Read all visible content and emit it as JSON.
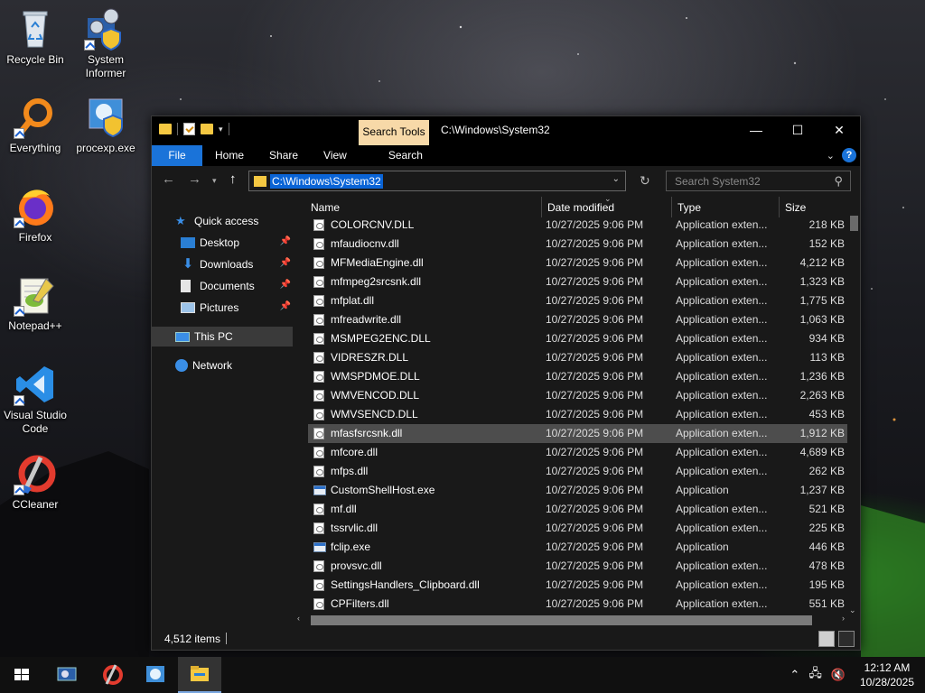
{
  "desktop": {
    "icons": [
      {
        "label": "Recycle Bin",
        "icon": "recycle-bin-icon"
      },
      {
        "label": "System Informer",
        "icon": "system-informer-icon"
      },
      {
        "label": "Everything",
        "icon": "everything-search-icon"
      },
      {
        "label": "procexp.exe",
        "icon": "process-explorer-icon"
      },
      {
        "label": "Firefox",
        "icon": "firefox-icon"
      },
      {
        "label": "Notepad++",
        "icon": "notepad-plus-plus-icon"
      },
      {
        "label": "Visual Studio Code",
        "icon": "vscode-icon"
      },
      {
        "label": "CCleaner",
        "icon": "ccleaner-icon"
      }
    ]
  },
  "window": {
    "title": "C:\\Windows\\System32",
    "context_tab": "Search Tools",
    "caption": {
      "minimize": "—",
      "maximize": "☐",
      "close": "✕"
    },
    "ribbon_tabs": [
      "File",
      "Home",
      "Share",
      "View",
      "Search"
    ],
    "address": {
      "path": "C:\\Windows\\System32"
    },
    "search": {
      "placeholder": "Search System32"
    },
    "nav_pane": [
      {
        "label": "Quick access",
        "icon": "star-icon",
        "pinned": false
      },
      {
        "label": "Desktop",
        "icon": "desktop-icon",
        "pinned": true
      },
      {
        "label": "Downloads",
        "icon": "download-icon",
        "pinned": true
      },
      {
        "label": "Documents",
        "icon": "documents-icon",
        "pinned": true
      },
      {
        "label": "Pictures",
        "icon": "pictures-icon",
        "pinned": true
      },
      {
        "label": "This PC",
        "icon": "computer-icon",
        "pinned": false,
        "selected": true
      },
      {
        "label": "Network",
        "icon": "network-icon",
        "pinned": false
      }
    ],
    "columns": [
      "Name",
      "Date modified",
      "Type",
      "Size"
    ],
    "files": [
      {
        "name": "COLORCNV.DLL",
        "date": "10/27/2025 9:06 PM",
        "type": "Application exten...",
        "size": "218 KB",
        "kind": "dll"
      },
      {
        "name": "mfaudiocnv.dll",
        "date": "10/27/2025 9:06 PM",
        "type": "Application exten...",
        "size": "152 KB",
        "kind": "dll"
      },
      {
        "name": "MFMediaEngine.dll",
        "date": "10/27/2025 9:06 PM",
        "type": "Application exten...",
        "size": "4,212 KB",
        "kind": "dll"
      },
      {
        "name": "mfmpeg2srcsnk.dll",
        "date": "10/27/2025 9:06 PM",
        "type": "Application exten...",
        "size": "1,323 KB",
        "kind": "dll"
      },
      {
        "name": "mfplat.dll",
        "date": "10/27/2025 9:06 PM",
        "type": "Application exten...",
        "size": "1,775 KB",
        "kind": "dll"
      },
      {
        "name": "mfreadwrite.dll",
        "date": "10/27/2025 9:06 PM",
        "type": "Application exten...",
        "size": "1,063 KB",
        "kind": "dll"
      },
      {
        "name": "MSMPEG2ENC.DLL",
        "date": "10/27/2025 9:06 PM",
        "type": "Application exten...",
        "size": "934 KB",
        "kind": "dll"
      },
      {
        "name": "VIDRESZR.DLL",
        "date": "10/27/2025 9:06 PM",
        "type": "Application exten...",
        "size": "113 KB",
        "kind": "dll"
      },
      {
        "name": "WMSPDMOE.DLL",
        "date": "10/27/2025 9:06 PM",
        "type": "Application exten...",
        "size": "1,236 KB",
        "kind": "dll"
      },
      {
        "name": "WMVENCOD.DLL",
        "date": "10/27/2025 9:06 PM",
        "type": "Application exten...",
        "size": "2,263 KB",
        "kind": "dll"
      },
      {
        "name": "WMVSENCD.DLL",
        "date": "10/27/2025 9:06 PM",
        "type": "Application exten...",
        "size": "453 KB",
        "kind": "dll"
      },
      {
        "name": "mfasfsrcsnk.dll",
        "date": "10/27/2025 9:06 PM",
        "type": "Application exten...",
        "size": "1,912 KB",
        "kind": "dll",
        "selected": true
      },
      {
        "name": "mfcore.dll",
        "date": "10/27/2025 9:06 PM",
        "type": "Application exten...",
        "size": "4,689 KB",
        "kind": "dll"
      },
      {
        "name": "mfps.dll",
        "date": "10/27/2025 9:06 PM",
        "type": "Application exten...",
        "size": "262 KB",
        "kind": "dll"
      },
      {
        "name": "CustomShellHost.exe",
        "date": "10/27/2025 9:06 PM",
        "type": "Application",
        "size": "1,237 KB",
        "kind": "exe"
      },
      {
        "name": "mf.dll",
        "date": "10/27/2025 9:06 PM",
        "type": "Application exten...",
        "size": "521 KB",
        "kind": "dll"
      },
      {
        "name": "tssrvlic.dll",
        "date": "10/27/2025 9:06 PM",
        "type": "Application exten...",
        "size": "225 KB",
        "kind": "dll"
      },
      {
        "name": "fclip.exe",
        "date": "10/27/2025 9:06 PM",
        "type": "Application",
        "size": "446 KB",
        "kind": "exe"
      },
      {
        "name": "provsvc.dll",
        "date": "10/27/2025 9:06 PM",
        "type": "Application exten...",
        "size": "478 KB",
        "kind": "dll"
      },
      {
        "name": "SettingsHandlers_Clipboard.dll",
        "date": "10/27/2025 9:06 PM",
        "type": "Application exten...",
        "size": "195 KB",
        "kind": "dll"
      },
      {
        "name": "CPFilters.dll",
        "date": "10/27/2025 9:06 PM",
        "type": "Application exten...",
        "size": "551 KB",
        "kind": "dll"
      }
    ],
    "status": {
      "item_count": "4,512 items"
    }
  },
  "taskbar": {
    "items": [
      {
        "icon": "start-windows-icon"
      },
      {
        "icon": "system-informer-taskbar-icon"
      },
      {
        "icon": "ccleaner-taskbar-icon"
      },
      {
        "icon": "process-explorer-taskbar-icon"
      },
      {
        "icon": "file-explorer-taskbar-icon",
        "active": true
      }
    ],
    "clock": {
      "time": "12:12 AM",
      "date": "10/28/2025"
    }
  }
}
